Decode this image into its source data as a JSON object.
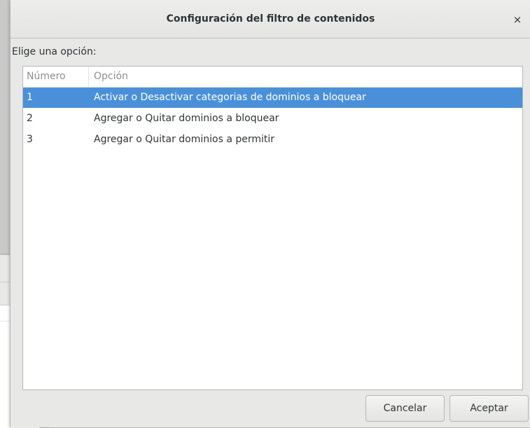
{
  "dialog": {
    "title": "Configuración del filtro de contenidos",
    "close_label": "×",
    "prompt": "Elige una opción:",
    "columns": [
      "Número",
      "Opción"
    ],
    "rows": [
      {
        "num": "1",
        "option": "Activar o Desactivar categorias de dominios a bloquear",
        "selected": true
      },
      {
        "num": "2",
        "option": "Agregar o Quitar dominios a bloquear",
        "selected": false
      },
      {
        "num": "3",
        "option": "Agregar o Quitar dominios a permitir",
        "selected": false
      }
    ],
    "buttons": {
      "cancel": "Cancelar",
      "ok": "Aceptar"
    }
  },
  "background_window": {
    "close_label": "×"
  },
  "colors": {
    "selection": "#4a90d9",
    "dialog_bg": "#e8e8e7",
    "text": "#2e3436"
  }
}
